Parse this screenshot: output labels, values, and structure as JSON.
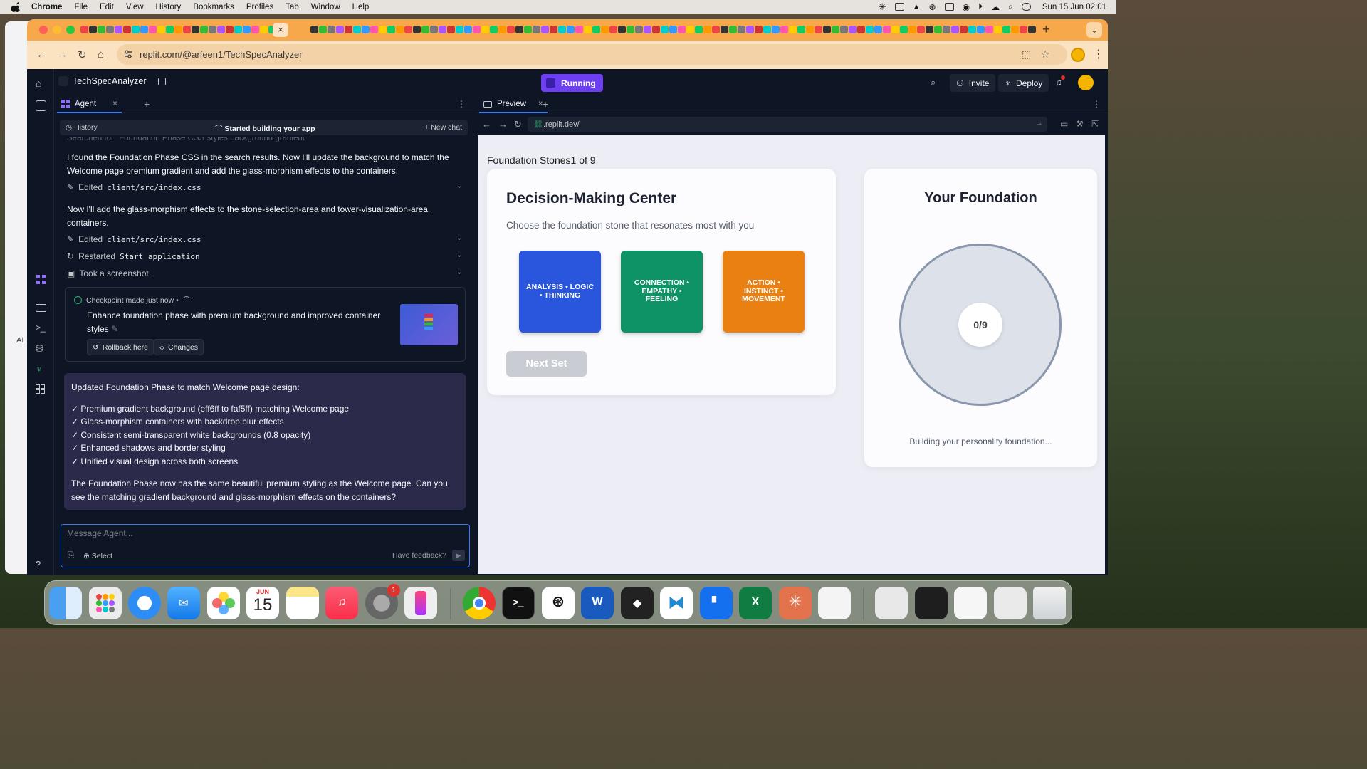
{
  "menubar": {
    "items": [
      "Chrome",
      "File",
      "Edit",
      "View",
      "History",
      "Bookmarks",
      "Profiles",
      "Tab",
      "Window",
      "Help"
    ],
    "clock": "Sun 15 Jun  02:01"
  },
  "browser": {
    "url": "replit.com/@arfeen1/TechSpecAnalyzer",
    "tab_close": "×",
    "new_tab": "+"
  },
  "replit": {
    "project_name": "TechSpecAnalyzer",
    "run_status": "Running",
    "invite_label": "Invite",
    "deploy_label": "Deploy"
  },
  "agent": {
    "tab_label": "Agent",
    "history_label": "History",
    "session_title": "Started building your app",
    "new_chat_label": "New chat",
    "ghost_text": "Searched for \"Foundation Phase CSS styles background gradient\"",
    "msg1": "I found the Foundation Phase CSS in the search results. Now I'll update the background to match the Welcome page premium gradient and add the glass-morphism effects to the containers.",
    "action1_prefix": "Edited",
    "action1_file": "client/src/index.css",
    "msg2": "Now I'll add the glass-morphism effects to the stone-selection-area and tower-visualization-area containers.",
    "action2_prefix": "Edited",
    "action2_file": "client/src/index.css",
    "action3_prefix": "Restarted",
    "action3_target": "Start application",
    "action4": "Took a screenshot",
    "checkpoint_meta": "Checkpoint made just now •",
    "checkpoint_text": "Enhance foundation phase with premium background and improved container styles",
    "rollback_label": "Rollback here",
    "changes_label": "Changes",
    "summary_intro": "Updated Foundation Phase to match Welcome page design:",
    "summary_points": [
      "✓ Premium gradient background (eff6ff to faf5ff) matching Welcome page",
      "✓ Glass-morphism containers with backdrop blur effects",
      "✓ Consistent semi-transparent white backgrounds (0.8 opacity)",
      "✓ Enhanced shadows and border styling",
      "✓ Unified visual design across both screens"
    ],
    "summary_outro": "The Foundation Phase now has the same beautiful premium styling as the Welcome page. Can you see the matching gradient background and glass-morphism effects on the containers?",
    "composer_placeholder": "Message Agent...",
    "select_label": "Select",
    "feedback_label": "Have feedback?"
  },
  "preview": {
    "tab_label": "Preview",
    "url": ".replit.dev/",
    "progress_label": "Foundation Stones1 of 9",
    "dm_title": "Decision-Making Center",
    "dm_subtitle": "Choose the foundation stone that resonates most with you",
    "stones": [
      {
        "label": "ANALYSIS • LOGIC • THINKING",
        "color": "#2a56dd"
      },
      {
        "label": "CONNECTION • EMPATHY • FEELING",
        "color": "#0d9365"
      },
      {
        "label": "ACTION • INSTINCT • MOVEMENT",
        "color": "#ea8012"
      }
    ],
    "next_label": "Next Set",
    "yf_title": "Your Foundation",
    "yf_count": "0/9",
    "yf_footer": "Building your personality foundation..."
  },
  "dock": {
    "calendar_month": "JUN",
    "calendar_day": "15",
    "settings_badge": "1"
  },
  "colors": {
    "tab_strip": "#f6a84b",
    "replit_bg": "#0e1525",
    "running": "#6e3ff2",
    "accent": "#3a7cf2"
  }
}
